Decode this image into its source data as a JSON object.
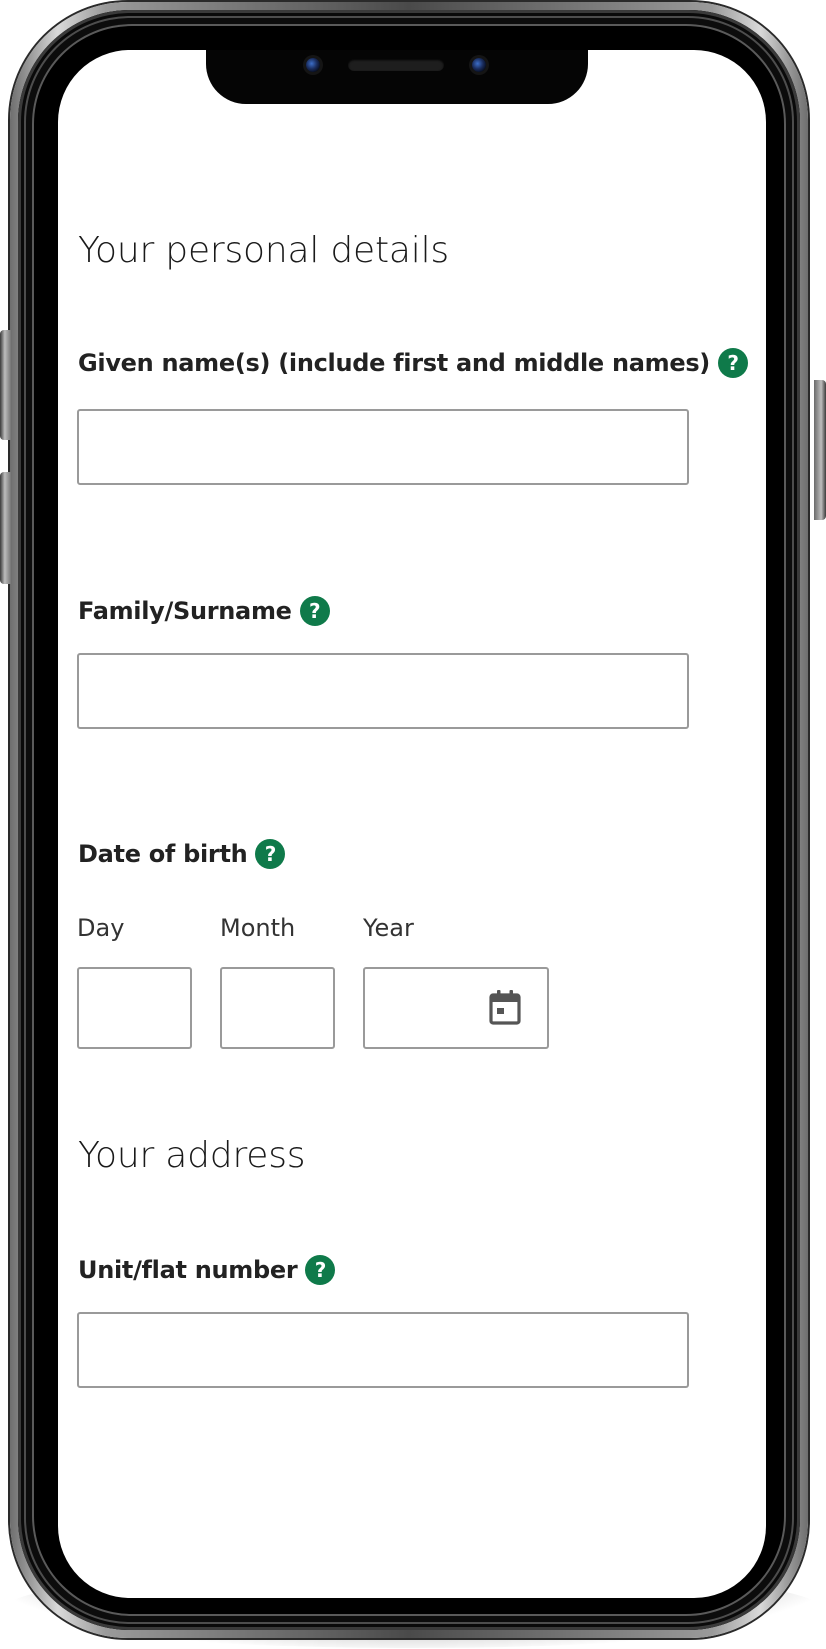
{
  "personal_details": {
    "heading": "Your personal details",
    "given_name": {
      "label": "Given name(s) (include first and middle names)",
      "value": "",
      "help_icon": "question-circle-icon"
    },
    "family_name": {
      "label": "Family/Surname",
      "value": "",
      "help_icon": "question-circle-icon"
    },
    "date_of_birth": {
      "label": "Date of birth",
      "help_icon": "question-circle-icon",
      "day_label": "Day",
      "month_label": "Month",
      "year_label": "Year",
      "day_value": "",
      "month_value": "",
      "year_value": "",
      "calendar_icon": "calendar-icon"
    }
  },
  "address": {
    "heading": "Your address",
    "unit_number": {
      "label": "Unit/flat number",
      "value": "",
      "help_icon": "question-circle-icon"
    }
  },
  "help_icon_glyph": "?",
  "colors": {
    "help_icon": "#0f7a4a",
    "input_border": "#9a9a9a",
    "text": "#222222",
    "phone_frame": "#0c0c0c"
  }
}
